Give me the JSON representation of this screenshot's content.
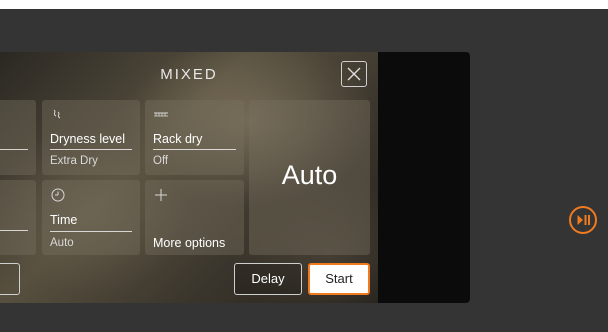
{
  "program": {
    "title": "MIXED"
  },
  "tiles": {
    "dryness": {
      "label": "Dryness level",
      "value": "Extra Dry",
      "icon": "dryness-icon"
    },
    "rack": {
      "label": "Rack dry",
      "value": "Off",
      "icon": "rack-icon"
    },
    "time": {
      "label": "Time",
      "value": "Auto",
      "icon": "clock-icon"
    },
    "more": {
      "label": "More options",
      "icon": "plus-icon"
    },
    "auto": {
      "label": "Auto"
    }
  },
  "actions": {
    "delay_label": "Delay",
    "start_label": "Start"
  },
  "colors": {
    "accent": "#f07a1e",
    "background": "#343434",
    "panel": "#0b0b0b"
  }
}
